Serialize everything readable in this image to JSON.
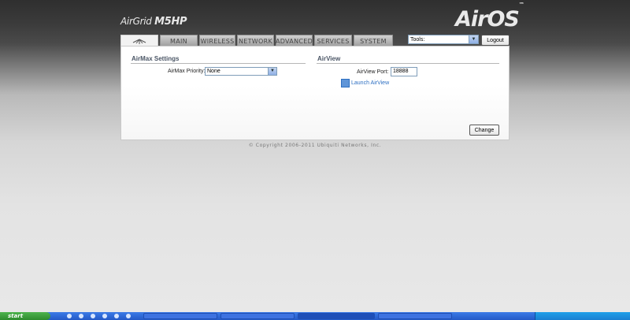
{
  "header": {
    "device_name": "AirGrid",
    "device_model": "M5HP",
    "product_logo": "AirOS",
    "product_logo_tm": "™"
  },
  "tabs": [
    {
      "label": "MAIN"
    },
    {
      "label": "WIRELESS"
    },
    {
      "label": "NETWORK"
    },
    {
      "label": "ADVANCED"
    },
    {
      "label": "SERVICES"
    },
    {
      "label": "SYSTEM"
    }
  ],
  "tools": {
    "value": "Tools:"
  },
  "logout_label": "Logout",
  "airmax": {
    "section_title": "AirMax Settings",
    "priority_label": "AirMax Priority:",
    "priority_value": "None"
  },
  "airview": {
    "section_title": "AirView",
    "port_label": "AirView Port:",
    "port_value": "18888",
    "launch_label": "Launch AirView"
  },
  "change_label": "Change",
  "copyright": "© Copyright 2006-2011 Ubiquiti Networks, Inc.",
  "taskbar": {
    "start_label": "start"
  },
  "icons": {
    "ubnt_logo": "ubiquiti-logo-icon",
    "dropdown": "chevron-down-icon",
    "launch": "airview-launch-icon"
  }
}
